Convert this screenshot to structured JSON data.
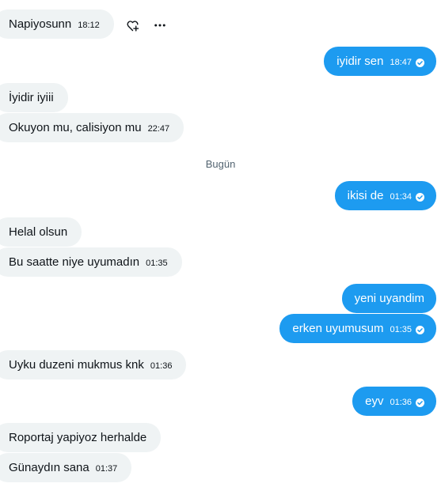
{
  "colors": {
    "sent_bubble": "#1d9bf0",
    "received_bubble": "#eff3f4",
    "text_dark": "#0f1419",
    "muted": "#536471"
  },
  "message_actions": {
    "react_icon": "heart-plus-icon",
    "more_icon": "more-horizontal-icon"
  },
  "date_separator": "Bugün",
  "messages": [
    {
      "direction": "received",
      "text": "Napiyosunn",
      "time": "18:12"
    },
    {
      "direction": "sent",
      "text": "iyidir sen",
      "time": "18:47",
      "status": "seen"
    },
    {
      "direction": "received",
      "text": "İyidir iyiii"
    },
    {
      "direction": "received",
      "text": "Okuyon mu, calisiyon mu",
      "time": "22:47"
    },
    {
      "direction": "sent",
      "text": "ikisi de",
      "time": "01:34",
      "status": "seen"
    },
    {
      "direction": "received",
      "text": "Helal olsun"
    },
    {
      "direction": "received",
      "text": "Bu saatte niye uyumadın",
      "time": "01:35"
    },
    {
      "direction": "sent",
      "text": "yeni uyandim"
    },
    {
      "direction": "sent",
      "text": "erken uyumusum",
      "time": "01:35",
      "status": "seen"
    },
    {
      "direction": "received",
      "text": "Uyku duzeni mukmus knk",
      "time": "01:36"
    },
    {
      "direction": "sent",
      "text": "eyv",
      "time": "01:36",
      "status": "seen"
    },
    {
      "direction": "received",
      "text": "Roportaj yapiyoz herhalde"
    },
    {
      "direction": "received",
      "text": "Günaydın sana",
      "time": "01:37"
    }
  ]
}
